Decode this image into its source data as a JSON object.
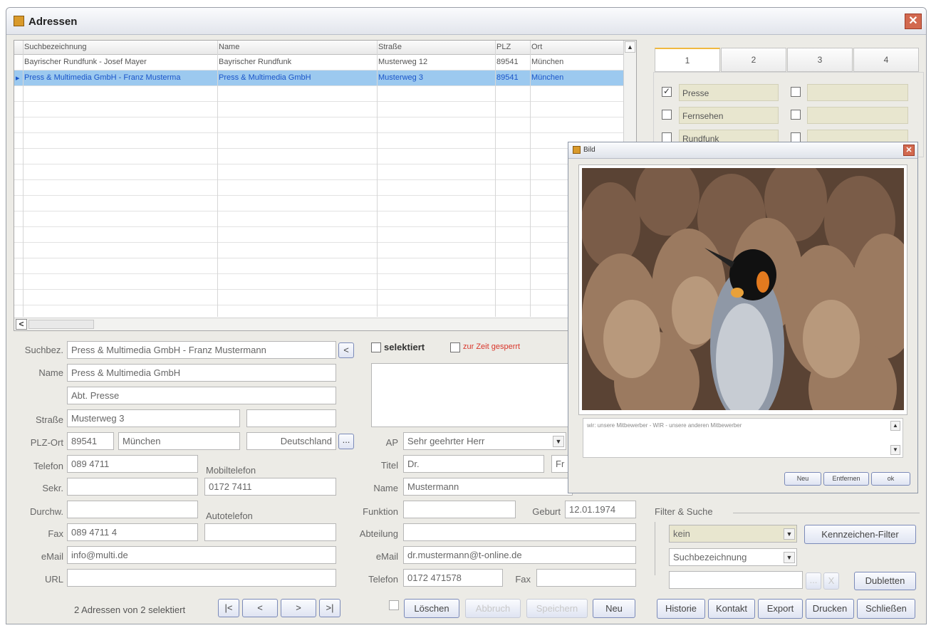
{
  "window": {
    "title": "Adressen"
  },
  "grid": {
    "headers": [
      "Suchbezeichnung",
      "Name",
      "Straße",
      "PLZ",
      "Ort"
    ],
    "rows": [
      [
        "Bayrischer Rundfunk - Josef Mayer",
        "Bayrischer Rundfunk",
        "Musterweg 12",
        "89541",
        "München"
      ],
      [
        "Press & Multimedia GmbH - Franz Musterma",
        "Press & Multimedia GmbH",
        "Musterweg 3",
        "89541",
        "München"
      ]
    ],
    "scroll_up": "▲",
    "scroll_left": "<"
  },
  "tabs": [
    "1",
    "2",
    "3",
    "4"
  ],
  "flags": {
    "left": [
      {
        "label": "Presse",
        "checked": "✓"
      },
      {
        "label": "Fernsehen",
        "checked": ""
      },
      {
        "label": "Rundfunk",
        "checked": ""
      }
    ]
  },
  "form": {
    "suchbez": {
      "label": "Suchbez.",
      "value": "Press & Multimedia GmbH - Franz Mustermann",
      "btn": "<"
    },
    "selektiert": {
      "label": "selektiert"
    },
    "gesperrt": {
      "label": "zur Zeit gesperrt"
    },
    "name": {
      "label": "Name",
      "value": "Press & Multimedia GmbH",
      "value2": "Abt. Presse"
    },
    "strasse": {
      "label": "Straße",
      "value": "Musterweg 3"
    },
    "plzort": {
      "label": "PLZ-Ort",
      "plz": "89541",
      "ort": "München",
      "land": "Deutschland",
      "btn": "..."
    },
    "telefon": {
      "label": "Telefon",
      "value": "089 4711"
    },
    "mobil": {
      "label": "Mobiltelefon",
      "value": "0172 7411"
    },
    "sekr": {
      "label": "Sekr."
    },
    "durchw": {
      "label": "Durchw."
    },
    "autotel": {
      "label": "Autotelefon"
    },
    "fax": {
      "label": "Fax",
      "value": "089 4711 4"
    },
    "email": {
      "label": "eMail",
      "value": "info@multi.de"
    },
    "url": {
      "label": "URL"
    },
    "ap": {
      "label": "AP",
      "value": "Sehr geehrter Herr"
    },
    "titel": {
      "label": "Titel",
      "value": "Dr.",
      "extra": "Fr"
    },
    "apname": {
      "label": "Name",
      "value": "Mustermann"
    },
    "funktion": {
      "label": "Funktion"
    },
    "geburt": {
      "label": "Geburt",
      "value": "12.01.1974"
    },
    "abteilung": {
      "label": "Abteilung"
    },
    "apemail": {
      "label": "eMail",
      "value": "dr.mustermann@t-online.de"
    },
    "aptelefon": {
      "label": "Telefon",
      "value": "0172 471578"
    },
    "apfax": {
      "label": "Fax"
    }
  },
  "nav": {
    "status": "2 Adressen von 2 selektiert",
    "first": "|<",
    "prev": "<",
    "next": ">",
    "last": ">|"
  },
  "actions": {
    "loeschen": "Löschen",
    "abbruch": "Abbruch",
    "speichern": "Speichern",
    "neu": "Neu"
  },
  "filter": {
    "title": "Filter & Suche",
    "filter_value": "kein",
    "kennzeichen": "Kennzeichen-Filter",
    "sort_value": "Suchbezeichnung",
    "dots": "...",
    "clear": "X",
    "dubletten": "Dubletten"
  },
  "bottom": {
    "historie": "Historie",
    "kontakt": "Kontakt",
    "export": "Export",
    "drucken": "Drucken",
    "schliessen": "Schließen"
  },
  "popup": {
    "title": "Bild",
    "caption": "wir: unsere Mitbewerber - WIR - unsere anderen Mitbewerber",
    "neu": "Neu",
    "entfernen": "Entfernen",
    "ok": "ok"
  },
  "colors": {
    "selection": "#9cc9ef",
    "tab_field": "#e8e6cf",
    "locked_red": "#d9352a",
    "close_red": "#d2694f"
  }
}
